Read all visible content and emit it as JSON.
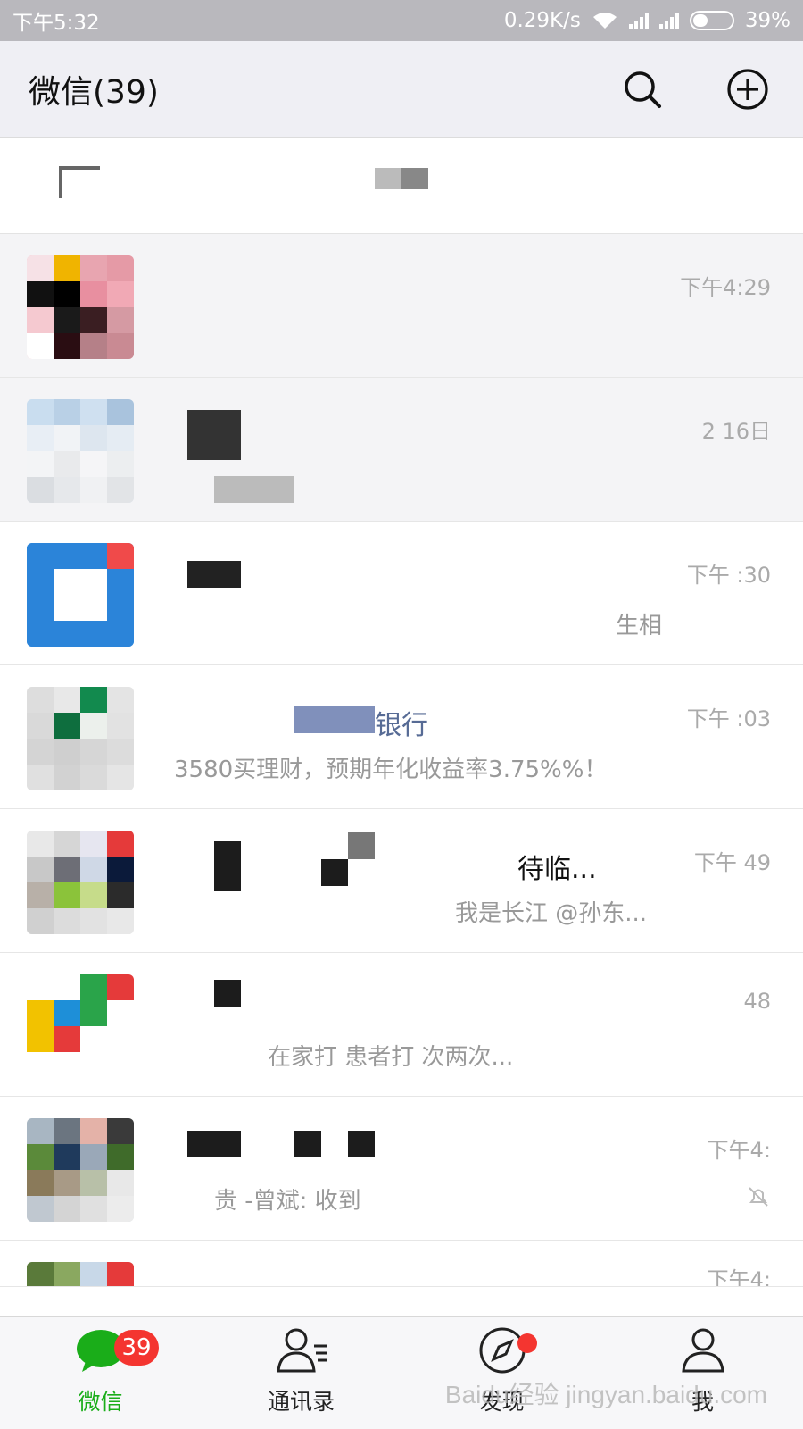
{
  "status_bar": {
    "time": "下午5:32",
    "network_speed": "0.29K/s",
    "battery_percent": "39%",
    "battery_level": 0.39
  },
  "header": {
    "title": "微信(39)",
    "search_icon": "search-icon",
    "add_icon": "plus-circle-icon"
  },
  "chats": [
    {
      "name": "",
      "preview": "",
      "time": "下午4:29",
      "avatar": "hat-avatar"
    },
    {
      "name": "",
      "preview": "",
      "time": "2 16日",
      "avatar": "sky-avatar"
    },
    {
      "name": "",
      "preview": "生相",
      "time": "下午 :30",
      "avatar": "blue-app-avatar"
    },
    {
      "name": "银行",
      "preview": "3580买理财，预期年化收益率3.75%%！",
      "time": "下午 :03",
      "avatar": "bank-avatar"
    },
    {
      "name": "待临...",
      "preview": "我是长江 @孙东...",
      "time": "下午 49",
      "avatar": "group-avatar"
    },
    {
      "name": "",
      "preview": "在家打 患者打 次两次...",
      "time": "48",
      "avatar": "green-app-avatar"
    },
    {
      "name": "",
      "preview": "贵 -曾斌: 收到",
      "time": "下午4:",
      "avatar": "photo-group-avatar"
    },
    {
      "name": "",
      "preview": "",
      "time": "下午4:",
      "avatar": "photo-group-avatar-2"
    }
  ],
  "tabs": [
    {
      "label": "微信",
      "icon": "chat-bubble-icon",
      "badge": "39",
      "active": true
    },
    {
      "label": "通讯录",
      "icon": "contacts-icon",
      "badge": "",
      "active": false
    },
    {
      "label": "发现",
      "icon": "compass-icon",
      "badge": "",
      "active": false
    },
    {
      "label": "我",
      "icon": "person-icon",
      "badge": "",
      "active": false
    }
  ],
  "watermark": "Baidu经验 jingyan.baidu.com",
  "colors": {
    "accent_green": "#1aad19",
    "badge_red": "#f43530",
    "status_bar_bg": "#b9b8bd",
    "header_bg": "#efeff4"
  }
}
